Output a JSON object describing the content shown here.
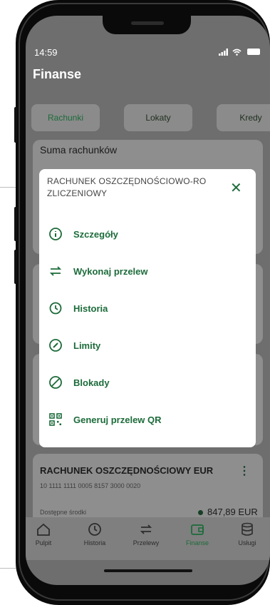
{
  "colors": {
    "accent": "#1c6b3a",
    "overlay": "#6e6e6e",
    "modal_bg": "#ffffff"
  },
  "status_bar": {
    "time": "14:59",
    "icons": "signal wifi battery"
  },
  "header": {
    "title": "Finanse"
  },
  "tabs": [
    {
      "label": "Rachunki",
      "selected": true
    },
    {
      "label": "Lokaty",
      "selected": false
    },
    {
      "label": "Kredy",
      "selected": false
    }
  ],
  "summary_card": {
    "title": "Suma rachunków"
  },
  "account_eur": {
    "name": "RACHUNEK OSZCZĘDNOŚCIOWY EUR",
    "number": "10 1111 1111 0005 8157 3000 0020",
    "available_label": "Dostępne środki",
    "amount": "847,89 EUR"
  },
  "modal": {
    "title": "RACHUNEK OSZCZĘDNOŚCIOWO-RO ZLICZENIOWY",
    "close_icon": "close-icon",
    "items": [
      {
        "label": "Szczegóły",
        "icon": "info-icon"
      },
      {
        "label": "Wykonaj przelew",
        "icon": "transfer-icon"
      },
      {
        "label": "Historia",
        "icon": "history-icon"
      },
      {
        "label": "Limity",
        "icon": "gauge-icon"
      },
      {
        "label": "Blokady",
        "icon": "block-icon"
      },
      {
        "label": "Generuj przelew QR",
        "icon": "qr-code-icon"
      }
    ]
  },
  "bottom_nav": [
    {
      "label": "Pulpit",
      "icon": "home-icon",
      "active": false
    },
    {
      "label": "Historia",
      "icon": "history-icon",
      "active": false
    },
    {
      "label": "Przelewy",
      "icon": "transfer-icon",
      "active": false
    },
    {
      "label": "Finanse",
      "icon": "wallet-icon",
      "active": true
    },
    {
      "label": "Usługi",
      "icon": "database-icon",
      "active": false
    }
  ]
}
